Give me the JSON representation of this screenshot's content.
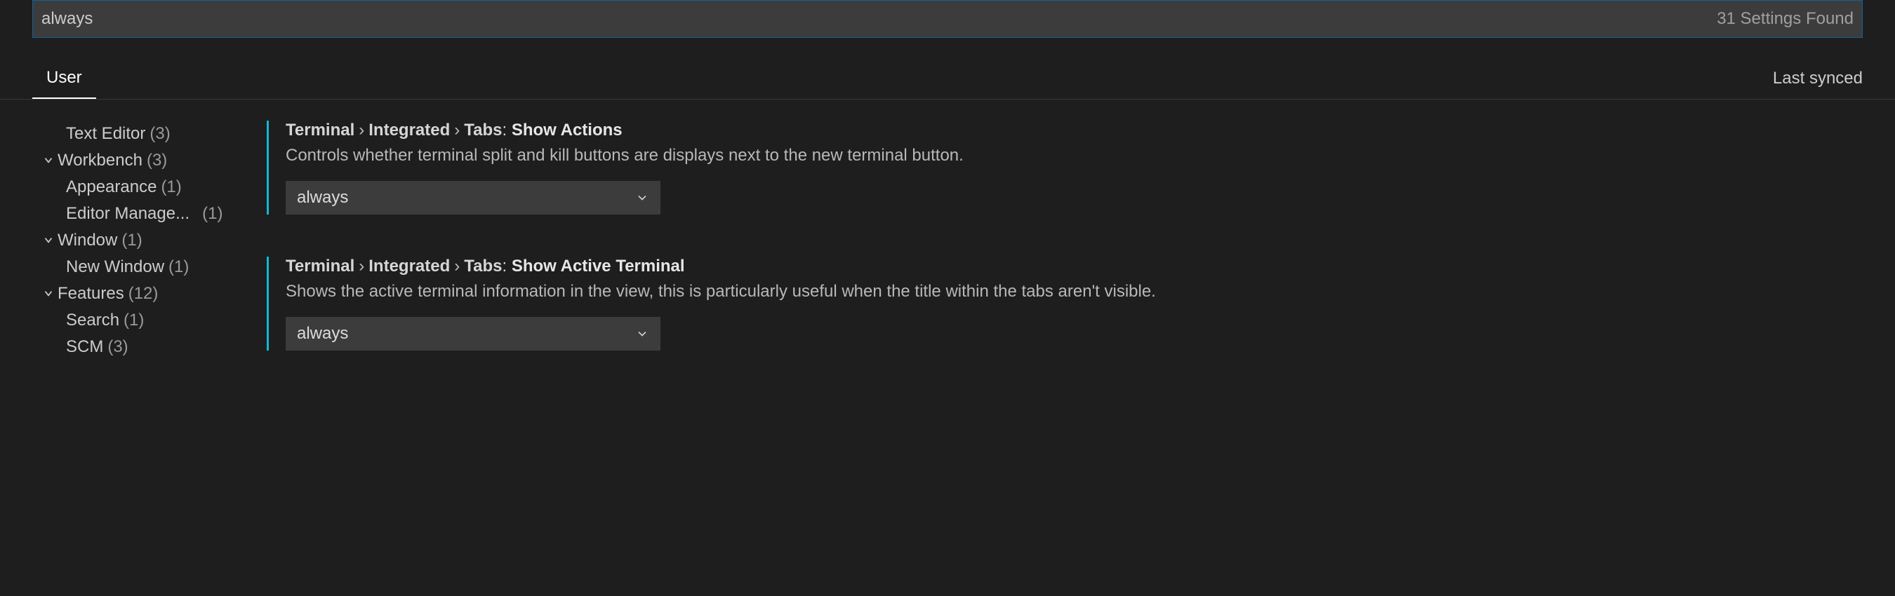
{
  "search": {
    "value": "always",
    "count_label": "31 Settings Found"
  },
  "tabs": {
    "user": "User",
    "sync": "Last synced"
  },
  "sidebar": {
    "items": [
      {
        "label": "Text Editor",
        "count": "(3)",
        "type": "leaf"
      },
      {
        "label": "Workbench",
        "count": "(3)",
        "type": "group"
      },
      {
        "label": "Appearance",
        "count": "(1)",
        "type": "leaf"
      },
      {
        "label": "Editor Manage...",
        "count": "(1)",
        "type": "leaf",
        "pad": true
      },
      {
        "label": "Window",
        "count": "(1)",
        "type": "group"
      },
      {
        "label": "New Window",
        "count": "(1)",
        "type": "leaf"
      },
      {
        "label": "Features",
        "count": "(12)",
        "type": "group"
      },
      {
        "label": "Search",
        "count": "(1)",
        "type": "leaf"
      },
      {
        "label": "SCM",
        "count": "(3)",
        "type": "leaf"
      }
    ]
  },
  "settings": [
    {
      "crumbs": [
        "Terminal",
        "Integrated",
        "Tabs"
      ],
      "name": "Show Actions",
      "desc": "Controls whether terminal split and kill buttons are displays next to the new terminal button.",
      "value": "always"
    },
    {
      "crumbs": [
        "Terminal",
        "Integrated",
        "Tabs"
      ],
      "name": "Show Active Terminal",
      "desc": "Shows the active terminal information in the view, this is particularly useful when the title within the tabs aren't visible.",
      "value": "always"
    }
  ]
}
